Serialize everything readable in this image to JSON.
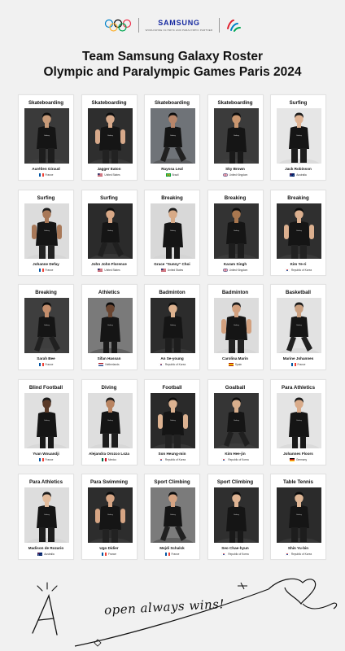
{
  "header": {
    "brand": "SAMSUNG",
    "partner_tag": "WORLDWIDE OLYMPIC AND PARALYMPIC PARTNER"
  },
  "title": {
    "line1": "Team Samsung Galaxy Roster",
    "line2": "Olympic and Paralympic Games Paris 2024"
  },
  "athletes": [
    {
      "sport": "Skateboarding",
      "name": "Aurélien Giraud",
      "country": "France",
      "flag": "fr",
      "bg": "#3a3a3a",
      "skin": "#c79a78"
    },
    {
      "sport": "Skateboarding",
      "name": "Jagger Eaton",
      "country": "United States",
      "flag": "us",
      "bg": "#2e2e2e",
      "skin": "#d7a98a"
    },
    {
      "sport": "Skateboarding",
      "name": "Rayssa Leal",
      "country": "Brazil",
      "flag": "br",
      "bg": "#6f7378",
      "skin": "#b8866a"
    },
    {
      "sport": "Skateboarding",
      "name": "Sky Brown",
      "country": "United Kingdom",
      "flag": "gb",
      "bg": "#3b3b3b",
      "skin": "#c9966f"
    },
    {
      "sport": "Surfing",
      "name": "Jack Robinson",
      "country": "Australia",
      "flag": "au",
      "bg": "#e6e6e6",
      "skin": "#e0b494"
    },
    {
      "sport": "Surfing",
      "name": "Johanne Defay",
      "country": "France",
      "flag": "fr",
      "bg": "#dcdcdc",
      "skin": "#a87858"
    },
    {
      "sport": "Surfing",
      "name": "John John Florence",
      "country": "United States",
      "flag": "us",
      "bg": "#2b2b2b",
      "skin": "#d9a886"
    },
    {
      "sport": "Breaking",
      "name": "Grace “Sunny” Choi",
      "country": "United States",
      "flag": "us",
      "bg": "#d8d8d8",
      "skin": "#d7aa87"
    },
    {
      "sport": "Breaking",
      "name": "Karam Singh",
      "country": "United Kingdom",
      "flag": "gb",
      "bg": "#333333",
      "skin": "#a9774f"
    },
    {
      "sport": "Breaking",
      "name": "Kim Ye-ri",
      "country": "Republic of Korea",
      "flag": "kr",
      "bg": "#2f2f2f",
      "skin": "#dcb08f"
    },
    {
      "sport": "Breaking",
      "name": "Sarah Bee",
      "country": "France",
      "flag": "fr",
      "bg": "#3e3e3e",
      "skin": "#c48e6c"
    },
    {
      "sport": "Athletics",
      "name": "Sifan Hassan",
      "country": "Netherlands",
      "flag": "nl",
      "bg": "#7a7a7a",
      "skin": "#6a4530"
    },
    {
      "sport": "Badminton",
      "name": "An Se-young",
      "country": "Republic of Korea",
      "flag": "kr",
      "bg": "#2c2c2c",
      "skin": "#ddb28f"
    },
    {
      "sport": "Badminton",
      "name": "Carolina Marin",
      "country": "Spain",
      "flag": "es",
      "bg": "#dcdcdc",
      "skin": "#d2a07e"
    },
    {
      "sport": "Basketball",
      "name": "Marine Johannes",
      "country": "France",
      "flag": "fr",
      "bg": "#e2e2e2",
      "skin": "#caa080"
    },
    {
      "sport": "Blind Football",
      "name": "Yvan Wouandji",
      "country": "France",
      "flag": "fr",
      "bg": "#e0e0e0",
      "skin": "#5a3a28"
    },
    {
      "sport": "Diving",
      "name": "Alejandra Orozco Loza",
      "country": "Mexico",
      "flag": "mx",
      "bg": "#dedede",
      "skin": "#b98461"
    },
    {
      "sport": "Football",
      "name": "Son Heung-min",
      "country": "Republic of Korea",
      "flag": "kr",
      "bg": "#2a2a2a",
      "skin": "#dcb291"
    },
    {
      "sport": "Goalball",
      "name": "Kim Hee-jin",
      "country": "Republic of Korea",
      "flag": "kr",
      "bg": "#353535",
      "skin": "#d8ae8c"
    },
    {
      "sport": "Para Athletics",
      "name": "Johannes Floors",
      "country": "Germany",
      "flag": "de",
      "bg": "#e4e4e4",
      "skin": "#d9ab8a"
    },
    {
      "sport": "Para Athletics",
      "name": "Madison de Rozario",
      "country": "Australia",
      "flag": "au",
      "bg": "#dddddd",
      "skin": "#e3bc9c"
    },
    {
      "sport": "Para Swimming",
      "name": "Ugo Didier",
      "country": "France",
      "flag": "fr",
      "bg": "#2d2d2d",
      "skin": "#d6a584"
    },
    {
      "sport": "Sport Climbing",
      "name": "Mejdi Schalck",
      "country": "France",
      "flag": "fr",
      "bg": "#7b7b7b",
      "skin": "#d4a382"
    },
    {
      "sport": "Sport Climbing",
      "name": "Seo Chae-hyun",
      "country": "Republic of Korea",
      "flag": "kr",
      "bg": "#2f2f2f",
      "skin": "#dfb493"
    },
    {
      "sport": "Table Tennis",
      "name": "Shin Yu-bin",
      "country": "Republic of Korea",
      "flag": "kr",
      "bg": "#2b2b2b",
      "skin": "#dfb695"
    }
  ],
  "footer": {
    "slogan": "open always wins!"
  }
}
